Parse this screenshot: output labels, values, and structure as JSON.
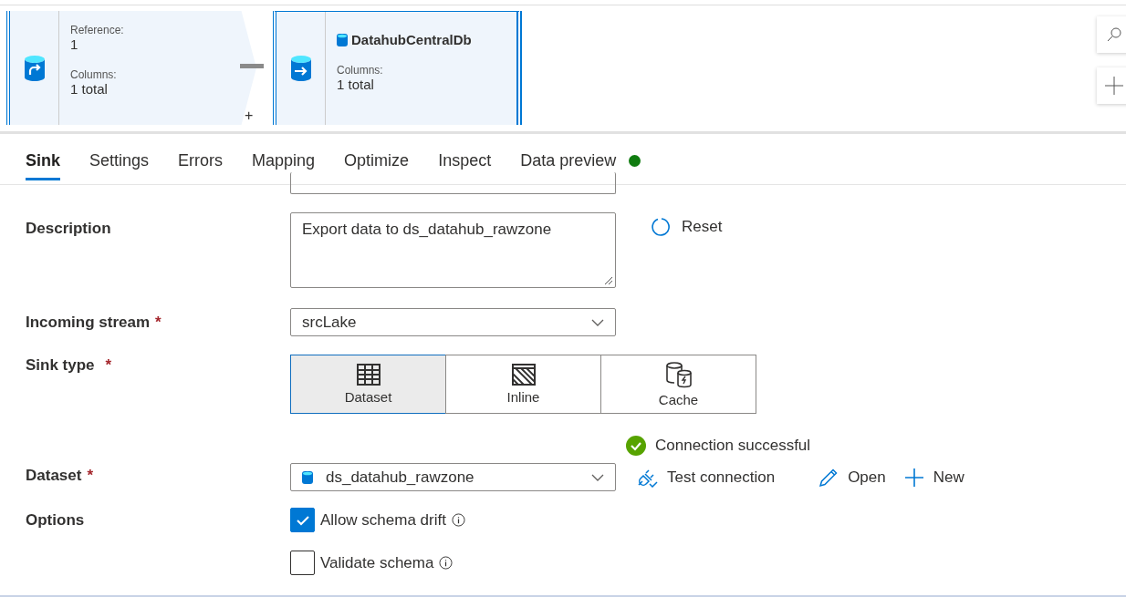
{
  "canvas": {
    "nodes": [
      {
        "kind": "source",
        "selected": false,
        "fields": [
          {
            "label": "Reference:",
            "value": "1"
          },
          {
            "label": "Columns:",
            "value": "1 total"
          }
        ]
      },
      {
        "kind": "sink",
        "selected": true,
        "title": "DatahubCentralDb",
        "fields": [
          {
            "label": "Columns:",
            "value": "1 total"
          }
        ]
      }
    ],
    "add_symbol": "+"
  },
  "tabs": [
    {
      "label": "Sink",
      "selected": true
    },
    {
      "label": "Settings",
      "selected": false
    },
    {
      "label": "Errors",
      "selected": false
    },
    {
      "label": "Mapping",
      "selected": false
    },
    {
      "label": "Optimize",
      "selected": false
    },
    {
      "label": "Inspect",
      "selected": false
    },
    {
      "label": "Data preview",
      "selected": false,
      "color": "#107c10"
    }
  ],
  "form": {
    "description": {
      "label": "Description",
      "value": "Export data to ds_datahub_rawzone",
      "reset": "Reset"
    },
    "incoming_stream": {
      "label": "Incoming stream",
      "required_mark": "*",
      "value": "srcLake"
    },
    "sink_type": {
      "label": "Sink type",
      "required_mark": "*",
      "options": [
        {
          "kind": "dataset",
          "label": "Dataset",
          "selected": true
        },
        {
          "kind": "inline",
          "label": "Inline",
          "selected": false
        },
        {
          "kind": "cache",
          "label": "Cache",
          "selected": false
        }
      ]
    },
    "connection_status": "Connection successful",
    "dataset": {
      "label": "Dataset",
      "required_mark": "*",
      "value": "ds_datahub_rawzone",
      "actions": [
        {
          "kind": "test",
          "label": "Test connection"
        },
        {
          "kind": "open",
          "label": "Open"
        },
        {
          "kind": "new",
          "label": "New"
        }
      ]
    },
    "options": {
      "label": "Options",
      "items": [
        {
          "label": "Allow schema drift",
          "checked": true
        },
        {
          "label": "Validate schema",
          "checked": false
        }
      ]
    }
  }
}
